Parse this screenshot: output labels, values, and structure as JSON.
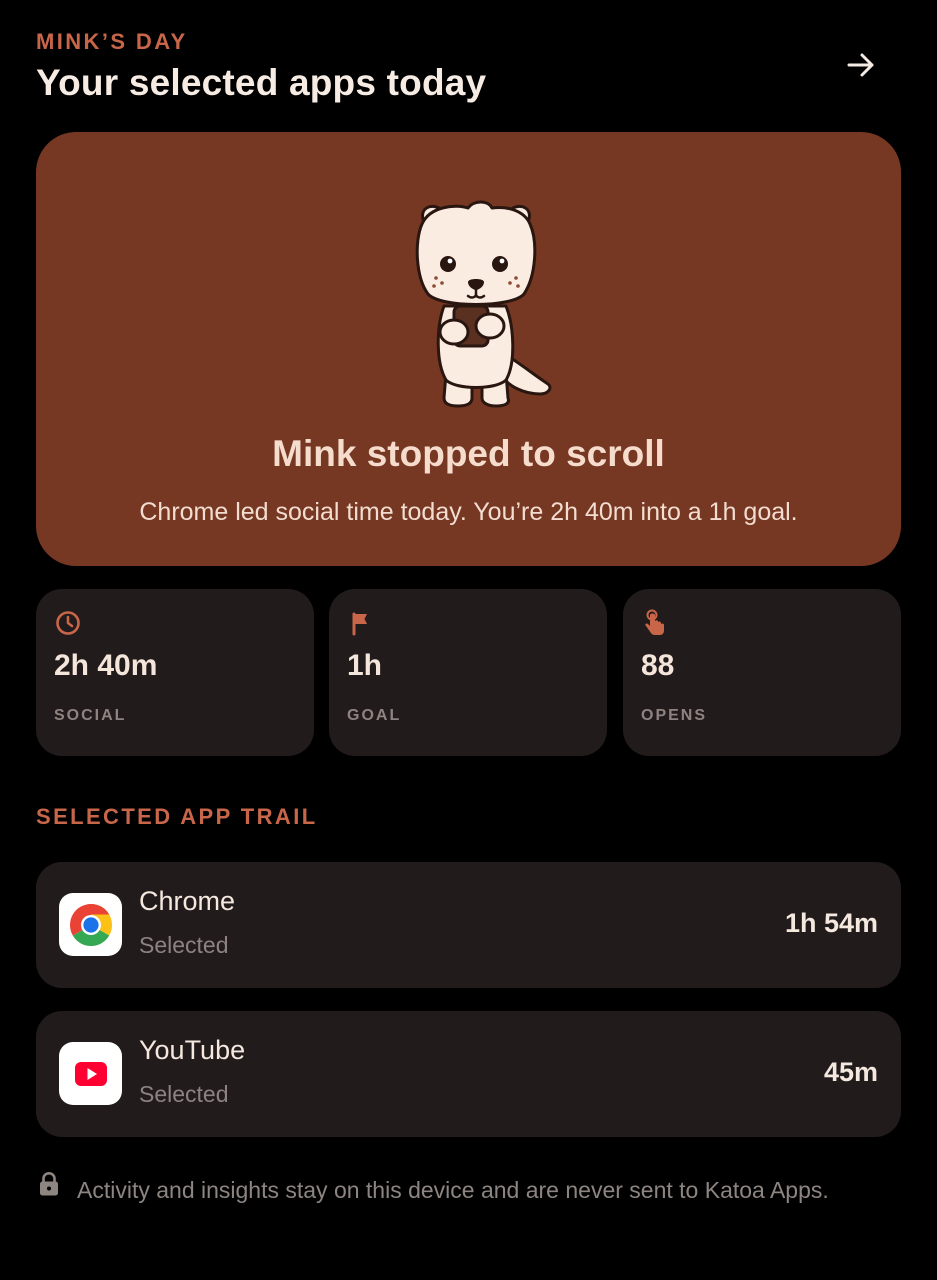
{
  "header": {
    "eyebrow": "MINK’S DAY",
    "title": "Your selected apps today",
    "next_icon": "arrow-right-icon"
  },
  "hero": {
    "mascot": "mink-holding-phone-illustration",
    "title": "Mink stopped to scroll",
    "subtitle": "Chrome led social time today. You’re 2h 40m into a 1h goal."
  },
  "stats": [
    {
      "icon": "clock-icon",
      "value": "2h 40m",
      "label": "SOCIAL"
    },
    {
      "icon": "flag-icon",
      "value": "1h",
      "label": "GOAL"
    },
    {
      "icon": "tap-icon",
      "value": "88",
      "label": "OPENS"
    }
  ],
  "trail": {
    "label": "SELECTED APP TRAIL",
    "apps": [
      {
        "icon": "chrome-icon",
        "name": "Chrome",
        "status": "Selected",
        "time": "1h 54m"
      },
      {
        "icon": "youtube-icon",
        "name": "YouTube",
        "status": "Selected",
        "time": "45m"
      }
    ]
  },
  "privacy": {
    "icon": "lock-icon",
    "note": "Activity and insights stay on this device and are never sent to Katoa Apps."
  },
  "colors": {
    "background": "#000000",
    "accent": "#c8664a",
    "hero": "#763723",
    "card": "#221b1b",
    "muted": "#8e8380"
  }
}
